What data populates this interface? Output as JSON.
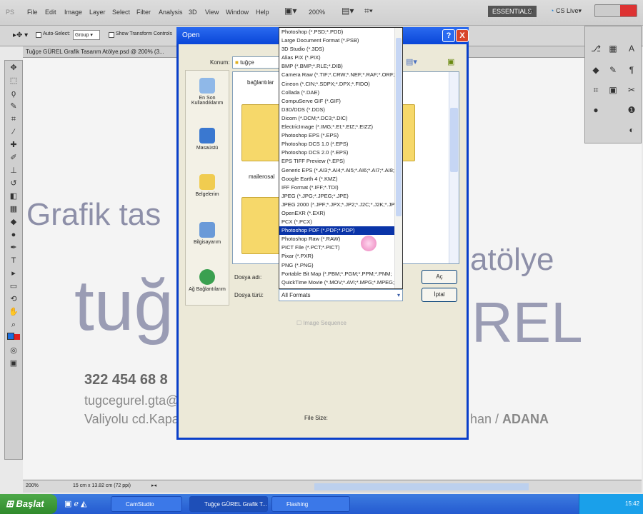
{
  "menubar": {
    "logo": "PS",
    "items": [
      "File",
      "Edit",
      "Image",
      "Layer",
      "Select",
      "Filter",
      "Analysis",
      "3D",
      "View",
      "Window",
      "Help"
    ],
    "zoom": "200%",
    "workspace": "ESSENTIALS",
    "cslive": "CS Live"
  },
  "options": {
    "auto_select": "Auto-Select:",
    "group": "Group",
    "show_transform": "Show Transform Controls"
  },
  "document": {
    "tab_title": "Tuğçe GÜREL Grafik Tasarım Atölye.psd @ 200% (3..."
  },
  "canvas": {
    "line1": "Grafik tas",
    "line1b": "atölye",
    "line2a": "tuğ",
    "line2b": "REL",
    "phone": "322 454 68 8",
    "email": "tugcegurel.gta@h",
    "address": "Valiyolu cd.Kapal",
    "city_prefix": "han / ",
    "city": "ADANA"
  },
  "status": {
    "zoom": "200%",
    "doc_size": "15 cm x 13.82 cm (72 ppi)"
  },
  "taskbar": {
    "start": "Başlat",
    "tasks": [
      "CamStudio",
      "Tuğçe GÜREL Grafik T...",
      "Flashing"
    ],
    "clock": "15:42"
  },
  "dialog": {
    "title": "Open",
    "help": "?",
    "close": "X",
    "look_in_label": "Konum:",
    "look_in_value": "tuğçe",
    "places": [
      "En Son Kullandıklarım",
      "Masaüstü",
      "Belgelerim",
      "Bilgisayarım",
      "Ağ Bağlantılarım"
    ],
    "files": [
      "bağlantılar",
      "mailerosal"
    ],
    "filename_label": "Dosya adı:",
    "filetype_label": "Dosya türü:",
    "filetype_value": "All Formats",
    "open_button": "Aç",
    "cancel_button": "İptal",
    "image_sequence": "Image Sequence",
    "file_size": "File Size:",
    "format_options": [
      "Photoshop (*.PSD;*.PDD)",
      "Large Document Format (*.PSB)",
      "3D Studio (*.3DS)",
      "Alias PIX (*.PIX)",
      "BMP (*.BMP;*.RLE;*.DIB)",
      "Camera Raw (*.TIF;*.CRW;*.NEF;*.RAF;*.ORF;",
      "Cineon (*.CIN;*.SDPX;*.DPX;*.FIDO)",
      "Collada (*.DAE)",
      "CompuServe GIF (*.GIF)",
      "D3D/DDS (*.DDS)",
      "Dicom (*.DCM;*.DC3;*.DIC)",
      "ElectricImage (*.IMG;*.EI;*.EIZ;*.EIZZ)",
      "Photoshop EPS (*.EPS)",
      "Photoshop DCS 1.0 (*.EPS)",
      "Photoshop DCS 2.0 (*.EPS)",
      "EPS TIFF Preview (*.EPS)",
      "Generic EPS (*.AI3;*.AI4;*.AI5;*.AI6;*.AI7;*.AI8;",
      "Google Earth 4 (*.KMZ)",
      "IFF Format (*.IFF;*.TDI)",
      "JPEG (*.JPG;*.JPEG;*.JPE)",
      "JPEG 2000 (*.JPF;*.JPX;*.JP2;*.J2C;*.J2K;*.JPC",
      "OpenEXR (*.EXR)",
      "PCX (*.PCX)",
      "Photoshop PDF (*.PDF;*.PDP)",
      "Photoshop Raw (*.RAW)",
      "PICT File (*.PCT;*.PICT)",
      "Pixar (*.PXR)",
      "PNG (*.PNG)",
      "Portable Bit Map (*.PBM;*.PGM;*.PPM;*.PNM;",
      "QuickTime Movie (*.MOV;*.AVI;*.MPG;*.MPEG;"
    ],
    "selected_index": 23
  }
}
